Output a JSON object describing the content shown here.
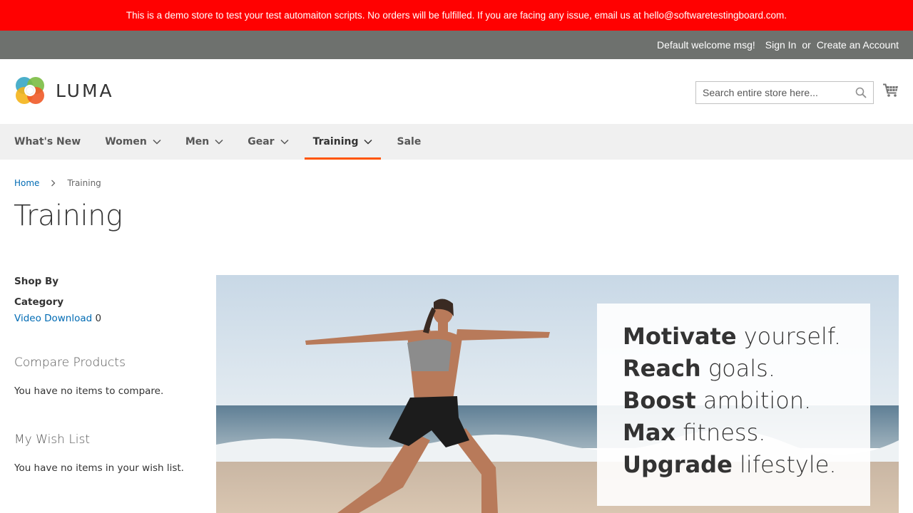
{
  "demo_notice": "This is a demo store to test your test automaiton scripts. No orders will be fulfilled. If you are facing any issue, email us at hello@softwaretestingboard.com.",
  "header_links": {
    "welcome": "Default welcome msg!",
    "sign_in": "Sign In",
    "or": "or",
    "create_account": "Create an Account"
  },
  "logo": {
    "text": "LUMA"
  },
  "search": {
    "placeholder": "Search entire store here..."
  },
  "nav": {
    "items": [
      {
        "label": "What's New"
      },
      {
        "label": "Women"
      },
      {
        "label": "Men"
      },
      {
        "label": "Gear"
      },
      {
        "label": "Training"
      },
      {
        "label": "Sale"
      }
    ]
  },
  "breadcrumb": {
    "home": "Home",
    "current": "Training"
  },
  "page_title": "Training",
  "sidebar": {
    "shop_by": "Shop By",
    "category_title": "Category",
    "category_item": {
      "label": "Video Download",
      "count": "0"
    },
    "compare_title": "Compare Products",
    "compare_empty": "You have no items to compare.",
    "wishlist_title": "My Wish List",
    "wishlist_empty": "You have no items in your wish list."
  },
  "promo": {
    "lines": [
      {
        "bold": "Motivate",
        "rest": " yourself."
      },
      {
        "bold": "Reach",
        "rest": " goals."
      },
      {
        "bold": "Boost",
        "rest": " ambition."
      },
      {
        "bold": "Max",
        "rest": " fitness."
      },
      {
        "bold": "Upgrade",
        "rest": " lifestyle."
      }
    ]
  },
  "colors": {
    "demo_bar": "#ff0101",
    "accent": "#ff5501",
    "link": "#006bb4"
  }
}
